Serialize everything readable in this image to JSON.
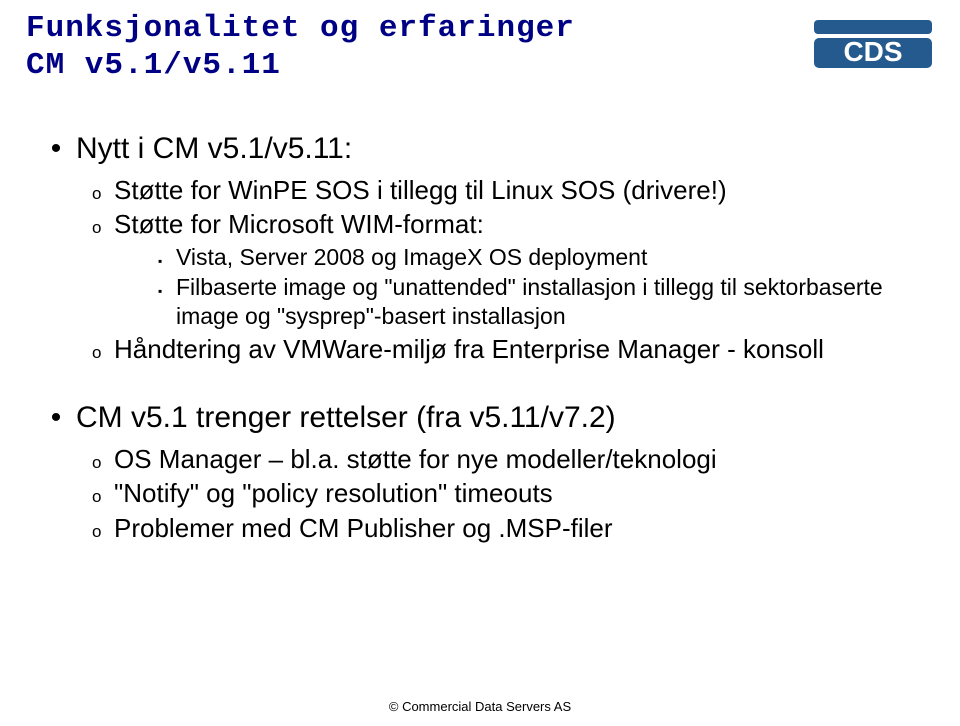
{
  "logo": {
    "text": "CDS"
  },
  "title": {
    "line1": "Funksjonalitet og erfaringer",
    "line2": "CM v5.1/v5.11"
  },
  "body": {
    "item1": {
      "label": "Nytt i CM v5.1/v5.11:",
      "sub1": "Støtte for WinPE SOS i tillegg til Linux SOS (drivere!)",
      "sub2": "Støtte for Microsoft WIM-format:",
      "sub2_a": "Vista, Server 2008 og ImageX OS deployment",
      "sub2_b": "Filbaserte image og \"unattended\" installasjon i tillegg til sektorbaserte image og \"sysprep\"-basert installasjon",
      "sub3": "Håndtering av VMWare-miljø fra Enterprise Manager - konsoll"
    },
    "item2": {
      "label": "CM v5.1 trenger rettelser (fra v5.11/v7.2)",
      "sub1": "OS Manager – bl.a. støtte for nye modeller/teknologi",
      "sub2": "\"Notify\" og \"policy resolution\" timeouts",
      "sub3": "Problemer med CM Publisher og .MSP-filer"
    }
  },
  "footer": "© Commercial Data Servers AS"
}
